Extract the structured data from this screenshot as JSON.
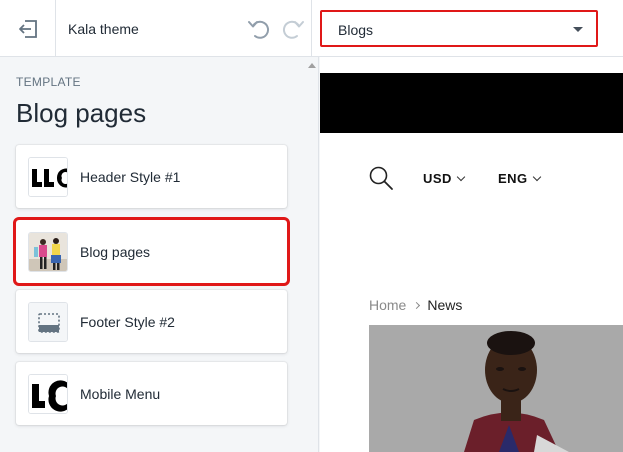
{
  "header": {
    "theme_name": "Kala theme",
    "page_select": {
      "selected": "Blogs",
      "options": [
        "Blogs"
      ]
    },
    "icons": {
      "back": "exit-icon",
      "undo": "undo-icon",
      "redo": "redo-icon"
    }
  },
  "sidebar": {
    "section_label": "TEMPLATE",
    "section_title": "Blog pages",
    "sections": [
      {
        "label": "Header Style #1",
        "selected": false
      },
      {
        "label": "Blog pages",
        "selected": true
      },
      {
        "label": "Footer Style #2",
        "selected": false
      },
      {
        "label": "Mobile Menu",
        "selected": false
      }
    ]
  },
  "preview": {
    "currency": "USD",
    "language": "ENG",
    "breadcrumb": {
      "home": "Home",
      "current": "News"
    }
  },
  "colors": {
    "highlight": "#e01818",
    "sidebar_bg": "#f4f6f8",
    "hero_band": "#000000"
  }
}
